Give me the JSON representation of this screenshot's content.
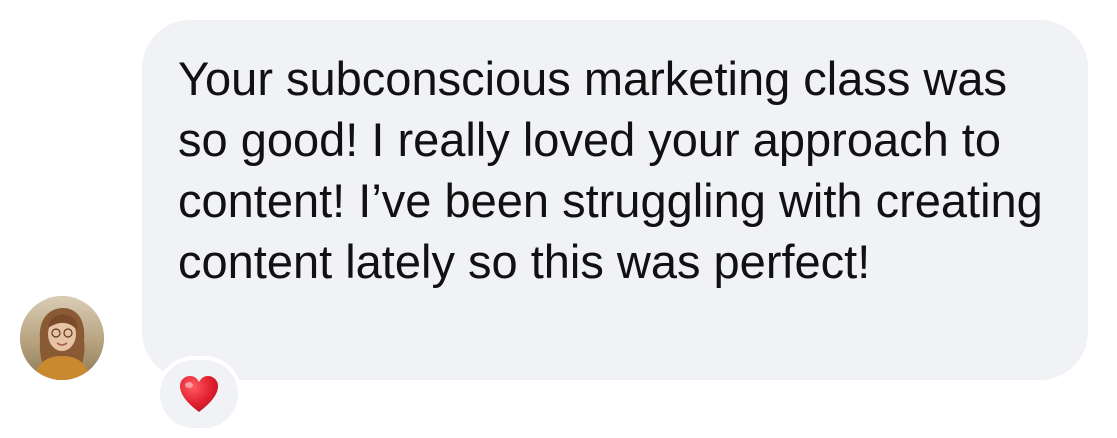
{
  "message": {
    "text": "Your subconscious marketing class was so good! I really loved your approach to content! I’ve been struggling with creating content lately so this was perfect!"
  },
  "sender": {
    "avatar_icon": "profile-photo"
  },
  "reaction": {
    "icon": "red-heart-icon",
    "color": "#e0202f"
  },
  "colors": {
    "bubble": "#f1f2f6",
    "text": "#111111",
    "background": "#ffffff"
  }
}
